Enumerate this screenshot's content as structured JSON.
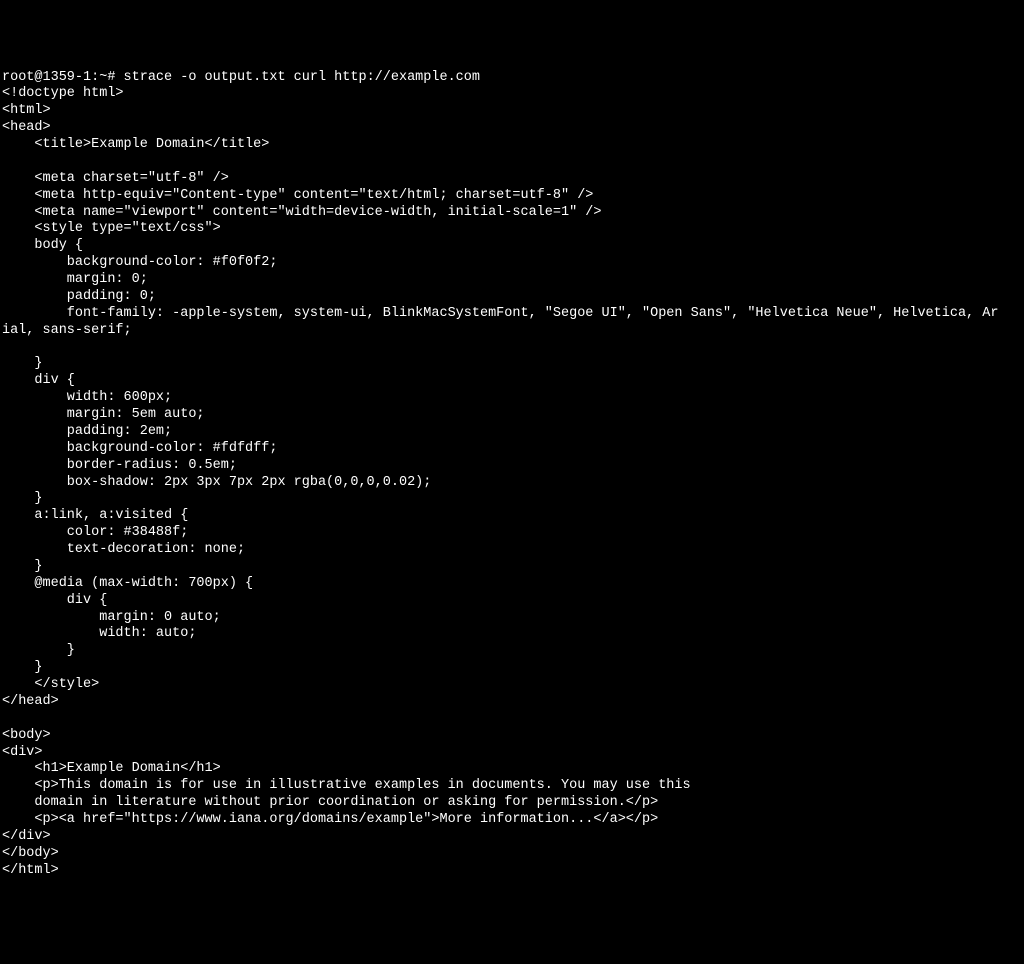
{
  "terminal": {
    "prompt": "root@1359-1:~# ",
    "command": "strace -o output.txt curl http://example.com",
    "lines": [
      "<!doctype html>",
      "<html>",
      "<head>",
      "    <title>Example Domain</title>",
      "",
      "    <meta charset=\"utf-8\" />",
      "    <meta http-equiv=\"Content-type\" content=\"text/html; charset=utf-8\" />",
      "    <meta name=\"viewport\" content=\"width=device-width, initial-scale=1\" />",
      "    <style type=\"text/css\">",
      "    body {",
      "        background-color: #f0f0f2;",
      "        margin: 0;",
      "        padding: 0;",
      "        font-family: -apple-system, system-ui, BlinkMacSystemFont, \"Segoe UI\", \"Open Sans\", \"Helvetica Neue\", Helvetica, Ar",
      "ial, sans-serif;",
      "",
      "    }",
      "    div {",
      "        width: 600px;",
      "        margin: 5em auto;",
      "        padding: 2em;",
      "        background-color: #fdfdff;",
      "        border-radius: 0.5em;",
      "        box-shadow: 2px 3px 7px 2px rgba(0,0,0,0.02);",
      "    }",
      "    a:link, a:visited {",
      "        color: #38488f;",
      "        text-decoration: none;",
      "    }",
      "    @media (max-width: 700px) {",
      "        div {",
      "            margin: 0 auto;",
      "            width: auto;",
      "        }",
      "    }",
      "    </style>",
      "</head>",
      "",
      "<body>",
      "<div>",
      "    <h1>Example Domain</h1>",
      "    <p>This domain is for use in illustrative examples in documents. You may use this",
      "    domain in literature without prior coordination or asking for permission.</p>",
      "    <p><a href=\"https://www.iana.org/domains/example\">More information...</a></p>",
      "</div>",
      "</body>",
      "</html>"
    ]
  }
}
